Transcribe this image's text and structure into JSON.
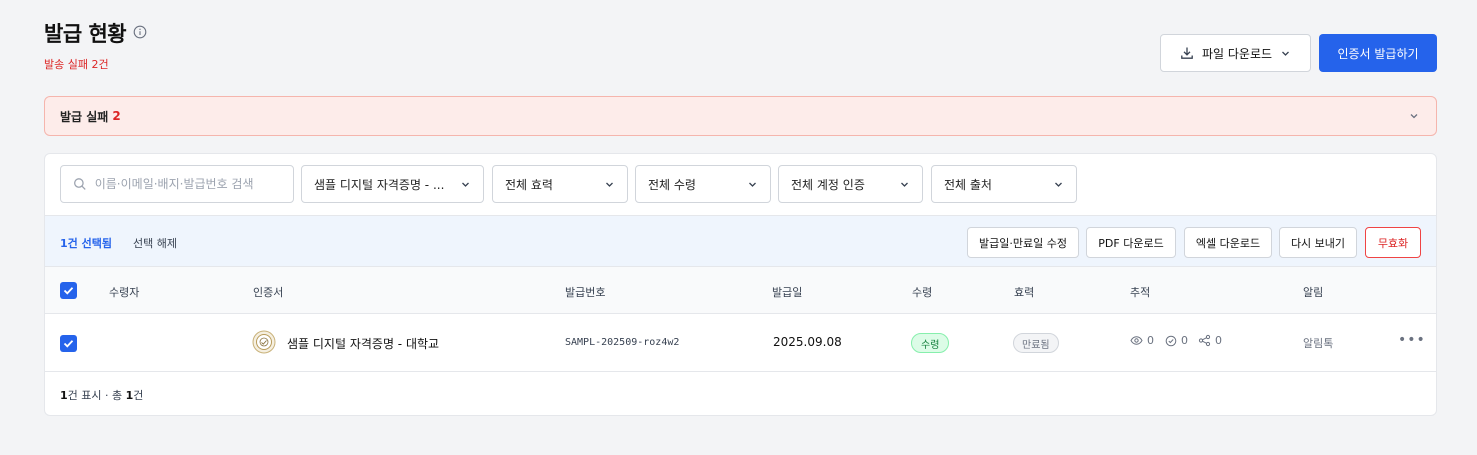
{
  "header": {
    "title": "발급 현황",
    "subtitle": "발송 실패 2건",
    "download_label": "파일 다운로드",
    "issue_label": "인증서 발급하기"
  },
  "alert": {
    "label": "발급 실패",
    "count": "2"
  },
  "filters": {
    "search_placeholder": "이름·이메일·배지·발급번호 검색",
    "certificate": "샘플 디지털 자격증명 - ...",
    "validity": "전체 효력",
    "receipt": "전체 수령",
    "account_verification": "전체 계정 인증",
    "source": "전체 출처"
  },
  "selection": {
    "count_label": "1건 선택됨",
    "clear_label": "선택 해제",
    "actions": [
      "발급일·만료일 수정",
      "PDF 다운로드",
      "엑셀 다운로드",
      "다시 보내기",
      "무효화"
    ]
  },
  "table": {
    "columns": [
      "수령자",
      "인증서",
      "발급번호",
      "발급일",
      "수령",
      "효력",
      "추적",
      "알림"
    ],
    "rows": [
      {
        "recipient": "",
        "certificate": "샘플 디지털 자격증명 - 대학교",
        "issue_number": "SAMPL-202509-roz4w2",
        "issue_date": "2025.09.08",
        "receipt": "수령",
        "validity": "만료됨",
        "views": "0",
        "verifications": "0",
        "shares": "0",
        "notification": "알림톡"
      }
    ]
  },
  "footer": {
    "shown": "1",
    "shown_suffix": "건 표시 · 총 ",
    "total": "1",
    "total_suffix": "건"
  },
  "colors": {
    "primary": "#2563eb",
    "danger": "#dc2626",
    "success": "#15803d"
  }
}
